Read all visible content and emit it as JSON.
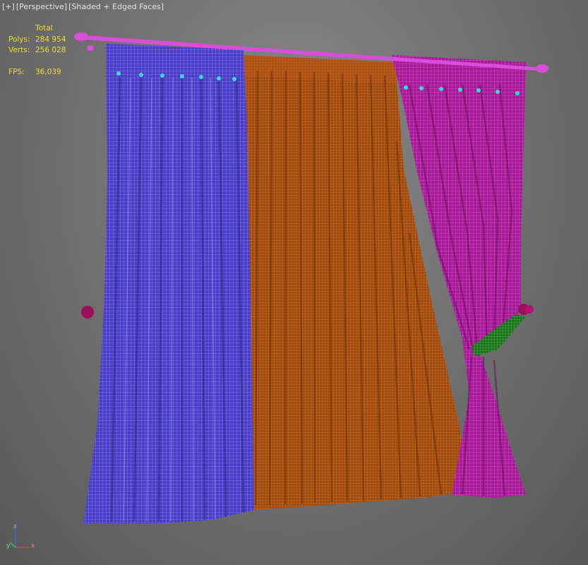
{
  "viewport": {
    "menu_label": "[+]",
    "view_label": "[Perspective]",
    "shading_label": "[Shaded + Edged Faces]"
  },
  "stats": {
    "header": "Total",
    "polys_label": "Polys:",
    "polys_value": "284 954",
    "verts_label": "Verts:",
    "verts_value": "256 028",
    "fps_label": "FPS:",
    "fps_value": "36,039"
  },
  "axis": {
    "x": "x",
    "y": "y",
    "z": "z"
  },
  "colors": {
    "left_curtain": "#6a5ae8",
    "middle_curtain": "#c2631a",
    "right_curtain": "#d62ac4",
    "rod": "#e050e0",
    "rings": "#3ad8d8",
    "tieback": "#2f9a2f",
    "knob": "#9a0e5a"
  }
}
